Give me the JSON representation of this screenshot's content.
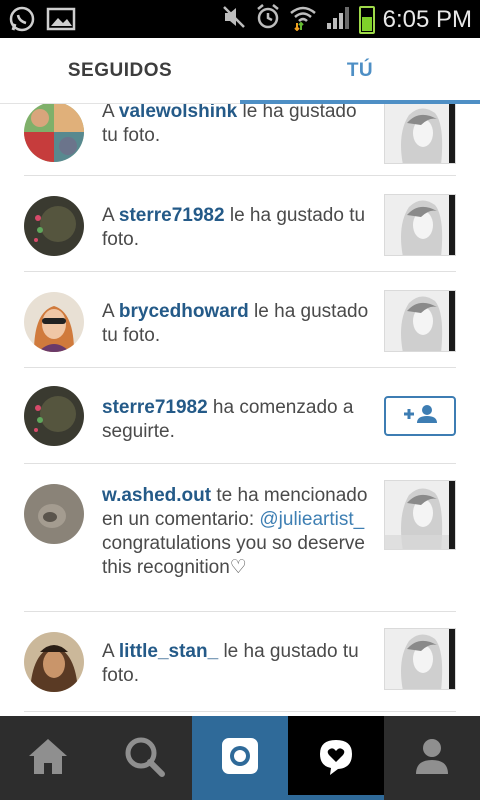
{
  "status_bar": {
    "time": "6:05 PM",
    "battery_level": 0.55
  },
  "tabs": {
    "following": "SEGUIDOS",
    "you": "TÚ",
    "active": "you"
  },
  "feed": [
    {
      "type": "like",
      "prefix": "A ",
      "username": "valewolshink",
      "suffix": " le ha gustado tu foto."
    },
    {
      "type": "like",
      "prefix": "A ",
      "username": "sterre71982",
      "suffix": " le ha gustado tu foto."
    },
    {
      "type": "like",
      "prefix": "A ",
      "username": "brycedhoward",
      "suffix": " le ha gustado tu foto."
    },
    {
      "type": "follow",
      "username": "sterre71982",
      "suffix": " ha comenzado a seguirte."
    },
    {
      "type": "mention",
      "username": "w.ashed.out",
      "middle": " te ha mencionado en un comentario: ",
      "mention": "@julieartist_",
      "tail": " congratulations you so deserve this recognition♡"
    },
    {
      "type": "like",
      "prefix": "A ",
      "username": "little_stan_",
      "suffix": " le ha gustado tu foto."
    }
  ],
  "icons": {
    "status_left": [
      "whatsapp-icon",
      "gallery-icon"
    ],
    "status_right": [
      "mute-icon",
      "alarm-icon",
      "wifi-icon",
      "signal-icon",
      "battery-icon"
    ],
    "bottom_nav": [
      "home-icon",
      "search-icon",
      "camera-icon",
      "activity-heart-icon",
      "profile-icon"
    ]
  },
  "colors": {
    "accent": "#4e8fc5",
    "username": "#245a88",
    "nav_background": "#2d2d2d",
    "camera_tab": "#2f6a99"
  }
}
